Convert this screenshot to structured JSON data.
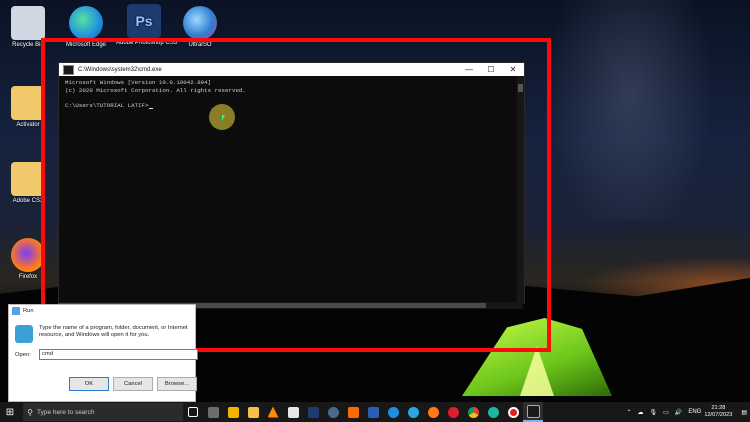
{
  "desktop": {
    "icons": [
      {
        "label": "Recycle Bin",
        "icon": "recycle-bin-icon",
        "color": "#cfd8e0"
      },
      {
        "label": "Microsoft Edge",
        "icon": "edge-icon",
        "color": "#1e8fe0"
      },
      {
        "label": "Adobe Photoshop CS3",
        "icon": "photoshop-icon",
        "color": "#1d3b6e"
      },
      {
        "label": "UltraISO",
        "icon": "ultraiso-icon",
        "color": "#2f7fd0"
      },
      {
        "label": "Activator",
        "icon": "folder-icon",
        "color": "#f1c86a"
      },
      {
        "label": "Adobe CS3",
        "icon": "folder-icon",
        "color": "#f1c86a"
      },
      {
        "label": "Firefox",
        "icon": "firefox-icon",
        "color": "#ff7a18"
      }
    ]
  },
  "cmd": {
    "title": "C:\\Windows\\system32\\cmd.exe",
    "lines": [
      "Microsoft Windows [Version 10.0.19042.804]",
      "(c) 2020 Microsoft Corporation. All rights reserved.",
      "",
      "C:\\Users\\TUTORIAL LATIF>"
    ],
    "minimize": "—",
    "maximize": "☐",
    "close": "✕"
  },
  "run": {
    "title": "Run",
    "description": "Type the name of a program, folder, document, or Internet resource, and Windows will open it for you.",
    "open_label": "Open:",
    "open_value": "cmd",
    "ok": "OK",
    "cancel": "Cancel",
    "browse": "Browse..."
  },
  "taskbar": {
    "search_placeholder": "Type here to search",
    "apps": [
      {
        "icon": "task-view-icon",
        "color": "#ffffff"
      },
      {
        "icon": "calculator-icon",
        "color": "#6d6d6d"
      },
      {
        "icon": "store-icon",
        "color": "#f2b400"
      },
      {
        "icon": "file-explorer-icon",
        "color": "#f6c04a"
      },
      {
        "icon": "vlc-icon",
        "color": "#ff8c00"
      },
      {
        "icon": "paint-icon",
        "color": "#e8e8e8"
      },
      {
        "icon": "photoshop-icon",
        "color": "#1d3b6e"
      },
      {
        "icon": "steam-icon",
        "color": "#4a6a8a"
      },
      {
        "icon": "sublime-icon",
        "color": "#ff6a00"
      },
      {
        "icon": "word-icon",
        "color": "#2b5fb4"
      },
      {
        "icon": "edge-icon",
        "color": "#1e8fe0"
      },
      {
        "icon": "edge-beta-icon",
        "color": "#2da6e0"
      },
      {
        "icon": "firefox-icon",
        "color": "#ff7a18"
      },
      {
        "icon": "opera-icon",
        "color": "#e01d2b"
      },
      {
        "icon": "chrome-icon",
        "color": "#f4c20d"
      },
      {
        "icon": "edge-dev-icon",
        "color": "#1fb5a3"
      },
      {
        "icon": "record-icon",
        "color": "#e81c1c"
      },
      {
        "icon": "cmd-icon",
        "color": "#1a1a1a"
      }
    ],
    "tray": {
      "lang": "ENG",
      "time": "21:28",
      "date": "12/07/2023"
    }
  }
}
